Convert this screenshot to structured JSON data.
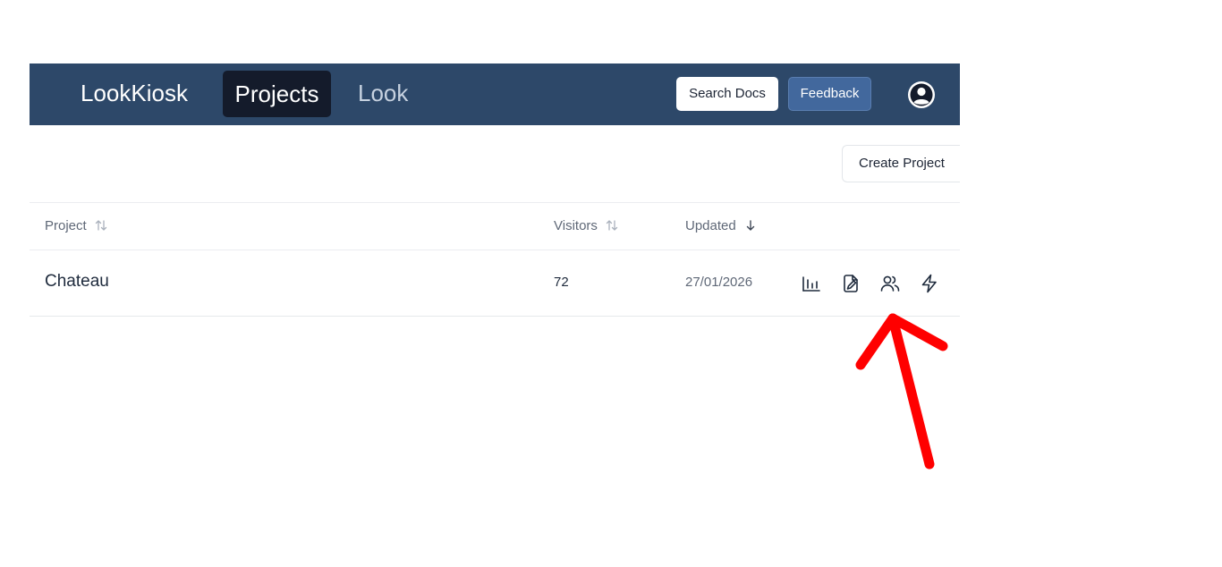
{
  "header": {
    "brand": "LookKiosk",
    "nav": [
      "Projects",
      "Look"
    ],
    "search_docs_label": "Search Docs",
    "feedback_label": "Feedback"
  },
  "toolbar": {
    "create_project_label": "Create Project"
  },
  "table": {
    "columns": [
      "Project",
      "Visitors",
      "Updated"
    ],
    "rows": [
      {
        "project": "Chateau",
        "visitors": "72",
        "updated": "27/01/2026"
      }
    ]
  },
  "icons": {
    "row_actions": [
      "bar-chart-icon",
      "file-edit-icon",
      "users-icon",
      "lightning-icon"
    ],
    "avatar": "user-circle-icon"
  },
  "colors": {
    "header_bg": "#2d4869",
    "active_nav_bg": "#141b2b",
    "feedback_bg": "#42689d",
    "annotation_arrow": "#ff0000"
  }
}
